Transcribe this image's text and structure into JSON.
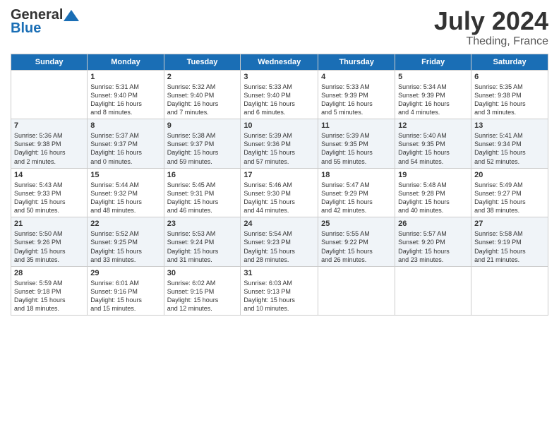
{
  "header": {
    "logo_general": "General",
    "logo_blue": "Blue",
    "month": "July 2024",
    "location": "Theding, France"
  },
  "weekdays": [
    "Sunday",
    "Monday",
    "Tuesday",
    "Wednesday",
    "Thursday",
    "Friday",
    "Saturday"
  ],
  "weeks": [
    [
      {
        "day": "",
        "info": ""
      },
      {
        "day": "1",
        "info": "Sunrise: 5:31 AM\nSunset: 9:40 PM\nDaylight: 16 hours\nand 8 minutes."
      },
      {
        "day": "2",
        "info": "Sunrise: 5:32 AM\nSunset: 9:40 PM\nDaylight: 16 hours\nand 7 minutes."
      },
      {
        "day": "3",
        "info": "Sunrise: 5:33 AM\nSunset: 9:40 PM\nDaylight: 16 hours\nand 6 minutes."
      },
      {
        "day": "4",
        "info": "Sunrise: 5:33 AM\nSunset: 9:39 PM\nDaylight: 16 hours\nand 5 minutes."
      },
      {
        "day": "5",
        "info": "Sunrise: 5:34 AM\nSunset: 9:39 PM\nDaylight: 16 hours\nand 4 minutes."
      },
      {
        "day": "6",
        "info": "Sunrise: 5:35 AM\nSunset: 9:38 PM\nDaylight: 16 hours\nand 3 minutes."
      }
    ],
    [
      {
        "day": "7",
        "info": "Sunrise: 5:36 AM\nSunset: 9:38 PM\nDaylight: 16 hours\nand 2 minutes."
      },
      {
        "day": "8",
        "info": "Sunrise: 5:37 AM\nSunset: 9:37 PM\nDaylight: 16 hours\nand 0 minutes."
      },
      {
        "day": "9",
        "info": "Sunrise: 5:38 AM\nSunset: 9:37 PM\nDaylight: 15 hours\nand 59 minutes."
      },
      {
        "day": "10",
        "info": "Sunrise: 5:39 AM\nSunset: 9:36 PM\nDaylight: 15 hours\nand 57 minutes."
      },
      {
        "day": "11",
        "info": "Sunrise: 5:39 AM\nSunset: 9:35 PM\nDaylight: 15 hours\nand 55 minutes."
      },
      {
        "day": "12",
        "info": "Sunrise: 5:40 AM\nSunset: 9:35 PM\nDaylight: 15 hours\nand 54 minutes."
      },
      {
        "day": "13",
        "info": "Sunrise: 5:41 AM\nSunset: 9:34 PM\nDaylight: 15 hours\nand 52 minutes."
      }
    ],
    [
      {
        "day": "14",
        "info": "Sunrise: 5:43 AM\nSunset: 9:33 PM\nDaylight: 15 hours\nand 50 minutes."
      },
      {
        "day": "15",
        "info": "Sunrise: 5:44 AM\nSunset: 9:32 PM\nDaylight: 15 hours\nand 48 minutes."
      },
      {
        "day": "16",
        "info": "Sunrise: 5:45 AM\nSunset: 9:31 PM\nDaylight: 15 hours\nand 46 minutes."
      },
      {
        "day": "17",
        "info": "Sunrise: 5:46 AM\nSunset: 9:30 PM\nDaylight: 15 hours\nand 44 minutes."
      },
      {
        "day": "18",
        "info": "Sunrise: 5:47 AM\nSunset: 9:29 PM\nDaylight: 15 hours\nand 42 minutes."
      },
      {
        "day": "19",
        "info": "Sunrise: 5:48 AM\nSunset: 9:28 PM\nDaylight: 15 hours\nand 40 minutes."
      },
      {
        "day": "20",
        "info": "Sunrise: 5:49 AM\nSunset: 9:27 PM\nDaylight: 15 hours\nand 38 minutes."
      }
    ],
    [
      {
        "day": "21",
        "info": "Sunrise: 5:50 AM\nSunset: 9:26 PM\nDaylight: 15 hours\nand 35 minutes."
      },
      {
        "day": "22",
        "info": "Sunrise: 5:52 AM\nSunset: 9:25 PM\nDaylight: 15 hours\nand 33 minutes."
      },
      {
        "day": "23",
        "info": "Sunrise: 5:53 AM\nSunset: 9:24 PM\nDaylight: 15 hours\nand 31 minutes."
      },
      {
        "day": "24",
        "info": "Sunrise: 5:54 AM\nSunset: 9:23 PM\nDaylight: 15 hours\nand 28 minutes."
      },
      {
        "day": "25",
        "info": "Sunrise: 5:55 AM\nSunset: 9:22 PM\nDaylight: 15 hours\nand 26 minutes."
      },
      {
        "day": "26",
        "info": "Sunrise: 5:57 AM\nSunset: 9:20 PM\nDaylight: 15 hours\nand 23 minutes."
      },
      {
        "day": "27",
        "info": "Sunrise: 5:58 AM\nSunset: 9:19 PM\nDaylight: 15 hours\nand 21 minutes."
      }
    ],
    [
      {
        "day": "28",
        "info": "Sunrise: 5:59 AM\nSunset: 9:18 PM\nDaylight: 15 hours\nand 18 minutes."
      },
      {
        "day": "29",
        "info": "Sunrise: 6:01 AM\nSunset: 9:16 PM\nDaylight: 15 hours\nand 15 minutes."
      },
      {
        "day": "30",
        "info": "Sunrise: 6:02 AM\nSunset: 9:15 PM\nDaylight: 15 hours\nand 12 minutes."
      },
      {
        "day": "31",
        "info": "Sunrise: 6:03 AM\nSunset: 9:13 PM\nDaylight: 15 hours\nand 10 minutes."
      },
      {
        "day": "",
        "info": ""
      },
      {
        "day": "",
        "info": ""
      },
      {
        "day": "",
        "info": ""
      }
    ]
  ]
}
